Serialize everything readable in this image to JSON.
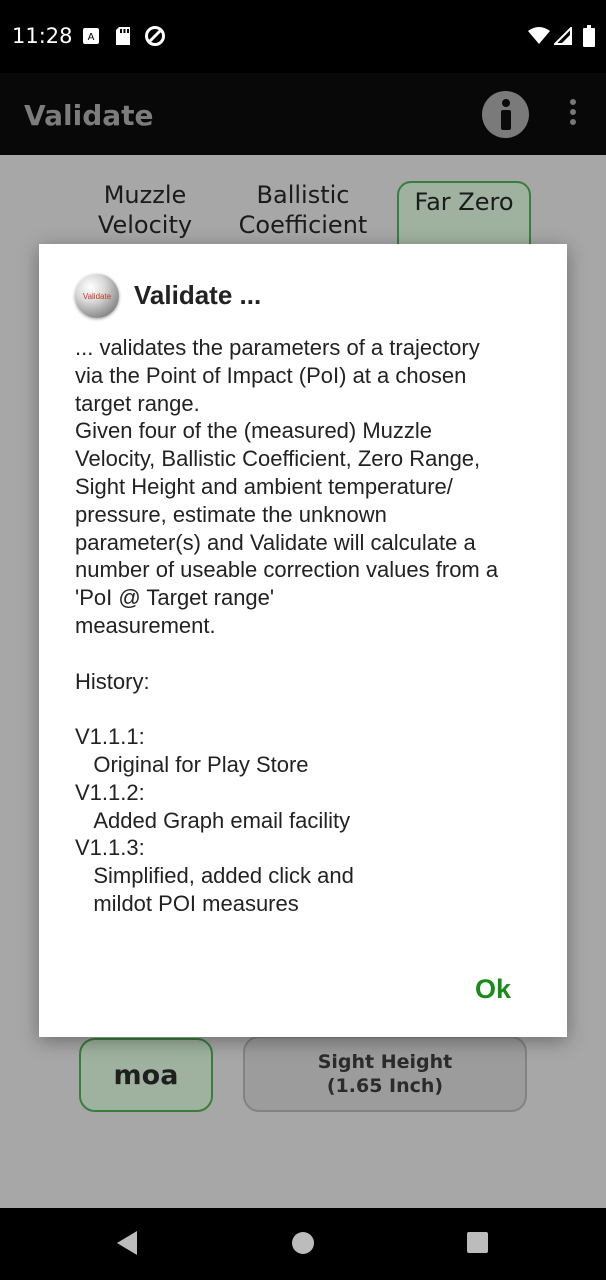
{
  "status_bar": {
    "time": "11:28",
    "icons": [
      "text-notification-icon",
      "sd-card-icon",
      "sync-icon",
      "wifi-icon",
      "signal-icon",
      "battery-icon"
    ]
  },
  "app_bar": {
    "title": "Validate",
    "info_icon": "info-icon",
    "overflow_icon": "more-vert-icon"
  },
  "background": {
    "tabs": [
      {
        "label": "Muzzle Velocity"
      },
      {
        "label": "Ballistic Coefficient"
      },
      {
        "label": "Far Zero"
      }
    ],
    "unit_button": "moa",
    "sight_height_button": "Sight Height\n(1.65 Inch)"
  },
  "dialog": {
    "icon_text": "Validate",
    "title": "Validate ...",
    "body": "... validates the parameters of a trajectory\nvia the Point of Impact (PoI) at a chosen\ntarget range.\nGiven four of the (measured) Muzzle\nVelocity, Ballistic Coefficient, Zero Range,\nSight Height and ambient temperature/\npressure, estimate the unknown\nparameter(s) and Validate will calculate a\nnumber of useable correction values from a\n'PoI @ Target range'\nmeasurement.\n\nHistory:\n\nV1.1.1:\n   Original for Play Store\nV1.1.2:\n   Added Graph email facility\nV1.1.3:\n   Simplified, added click and\n   mildot POI measures",
    "ok_label": "Ok"
  },
  "nav_bar": {
    "back": "back-icon",
    "home": "home-icon",
    "recents": "recents-icon"
  },
  "colors": {
    "accent_green": "#1a8a1a",
    "scrim": "#a7a7a7"
  }
}
